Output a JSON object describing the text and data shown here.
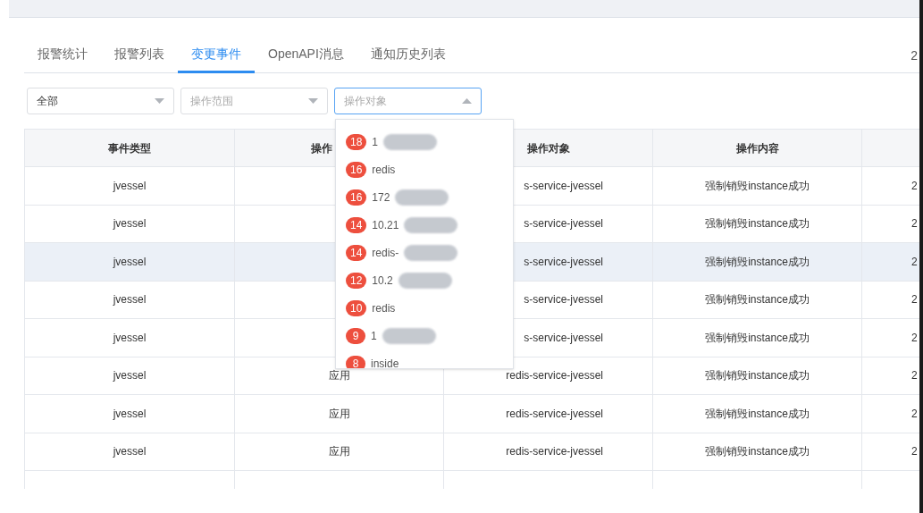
{
  "tabs": [
    {
      "label": "报警统计",
      "selected": false
    },
    {
      "label": "报警列表",
      "selected": false
    },
    {
      "label": "变更事件",
      "selected": true
    },
    {
      "label": "OpenAPI消息",
      "selected": false
    },
    {
      "label": "通知历史列表",
      "selected": false
    }
  ],
  "tab_row_edge_text": "2",
  "filters": [
    {
      "value": "全部",
      "expanded": false
    },
    {
      "placeholder": "操作范围",
      "expanded": false
    },
    {
      "placeholder": "操作对象",
      "expanded": true
    }
  ],
  "dropdown": {
    "items": [
      {
        "count": "18",
        "label": "1",
        "redacted": true
      },
      {
        "count": "16",
        "label": "redis",
        "redacted": false
      },
      {
        "count": "16",
        "label": "172",
        "redacted": true
      },
      {
        "count": "14",
        "label": "10.21",
        "redacted": true
      },
      {
        "count": "14",
        "label": "redis-",
        "redacted": true
      },
      {
        "count": "12",
        "label": "10.2",
        "redacted": true
      },
      {
        "count": "10",
        "label": "redis",
        "redacted": false
      },
      {
        "count": "9",
        "label": "1",
        "redacted": true
      },
      {
        "count": "8",
        "label": "inside",
        "redacted": false
      }
    ]
  },
  "table": {
    "columns": [
      "事件类型",
      "操作",
      "操作对象",
      "操作内容"
    ],
    "rows": [
      {
        "cells": [
          "jvessel",
          null,
          "s-service-jvessel",
          "强制销毁instance成功",
          "2"
        ],
        "hovered": false
      },
      {
        "cells": [
          "jvessel",
          null,
          "s-service-jvessel",
          "强制销毁instance成功",
          "2"
        ],
        "hovered": false
      },
      {
        "cells": [
          "jvessel",
          null,
          "s-service-jvessel",
          "强制销毁instance成功",
          "2"
        ],
        "hovered": true
      },
      {
        "cells": [
          "jvessel",
          null,
          "s-service-jvessel",
          "强制销毁instance成功",
          "2"
        ],
        "hovered": false
      },
      {
        "cells": [
          "jvessel",
          null,
          "s-service-jvessel",
          "强制销毁instance成功",
          "2"
        ],
        "hovered": false
      },
      {
        "cells": [
          "jvessel",
          "应用",
          "redis-service-jvessel",
          "强制销毁instance成功",
          "2"
        ],
        "hovered": false
      },
      {
        "cells": [
          "jvessel",
          "应用",
          "redis-service-jvessel",
          "强制销毁instance成功",
          "2"
        ],
        "hovered": false
      },
      {
        "cells": [
          "jvessel",
          "应用",
          "redis-service-jvessel",
          "强制销毁instance成功",
          "2"
        ],
        "hovered": false
      }
    ]
  }
}
